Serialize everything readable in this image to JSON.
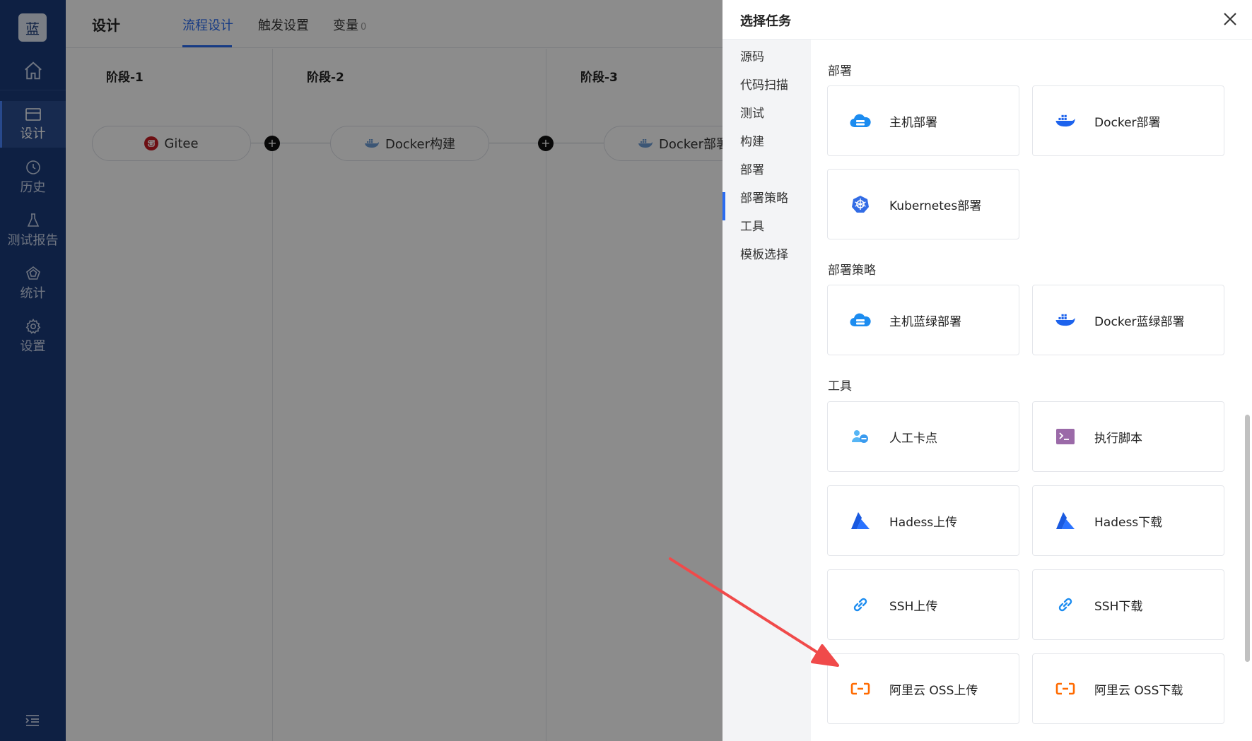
{
  "sidebar": {
    "logo": "蓝",
    "items": [
      {
        "label": "设计",
        "icon": "card-icon"
      },
      {
        "label": "历史",
        "icon": "clock-icon"
      },
      {
        "label": "测试报告",
        "icon": "flask-icon"
      },
      {
        "label": "统计",
        "icon": "pentagon-icon"
      },
      {
        "label": "设置",
        "icon": "gear-icon"
      }
    ]
  },
  "header": {
    "title": "设计",
    "tabs": [
      {
        "label": "流程设计"
      },
      {
        "label": "触发设置"
      },
      {
        "label": "变量",
        "count": "0"
      }
    ]
  },
  "pipeline": {
    "stages": [
      {
        "title": "阶段-1",
        "job": "Gitee"
      },
      {
        "title": "阶段-2",
        "job": "Docker构建"
      },
      {
        "title": "阶段-3",
        "job": "Docker部署"
      }
    ],
    "add_symbol": "+"
  },
  "drawer": {
    "title": "选择任务",
    "categories": [
      "源码",
      "代码扫描",
      "测试",
      "构建",
      "部署",
      "部署策略",
      "工具",
      "模板选择"
    ],
    "active_category": "部署",
    "sections": [
      {
        "title": "部署",
        "tasks": [
          {
            "label": "主机部署",
            "icon": "cloud-server-icon"
          },
          {
            "label": "Docker部署",
            "icon": "docker-icon"
          },
          {
            "label": "Kubernetes部署",
            "icon": "kubernetes-icon"
          }
        ]
      },
      {
        "title": "部署策略",
        "tasks": [
          {
            "label": "主机蓝绿部署",
            "icon": "cloud-server-icon"
          },
          {
            "label": "Docker蓝绿部署",
            "icon": "docker-icon"
          }
        ]
      },
      {
        "title": "工具",
        "tasks": [
          {
            "label": "人工卡点",
            "icon": "user-minus-icon"
          },
          {
            "label": "执行脚本",
            "icon": "terminal-icon"
          },
          {
            "label": "Hadess上传",
            "icon": "hadess-icon"
          },
          {
            "label": "Hadess下载",
            "icon": "hadess-icon"
          },
          {
            "label": "SSH上传",
            "icon": "link-icon"
          },
          {
            "label": "SSH下载",
            "icon": "link-icon"
          },
          {
            "label": "阿里云 OSS上传",
            "icon": "aliyun-icon"
          },
          {
            "label": "阿里云 OSS下载",
            "icon": "aliyun-icon"
          }
        ]
      }
    ]
  },
  "colors": {
    "sidebar_bg": "#1b3b7a",
    "accent": "#2b6cf0",
    "annotation_arrow": "#f04a4a",
    "aliyun_orange": "#ff6a00",
    "docker_blue": "#1d63ed"
  }
}
